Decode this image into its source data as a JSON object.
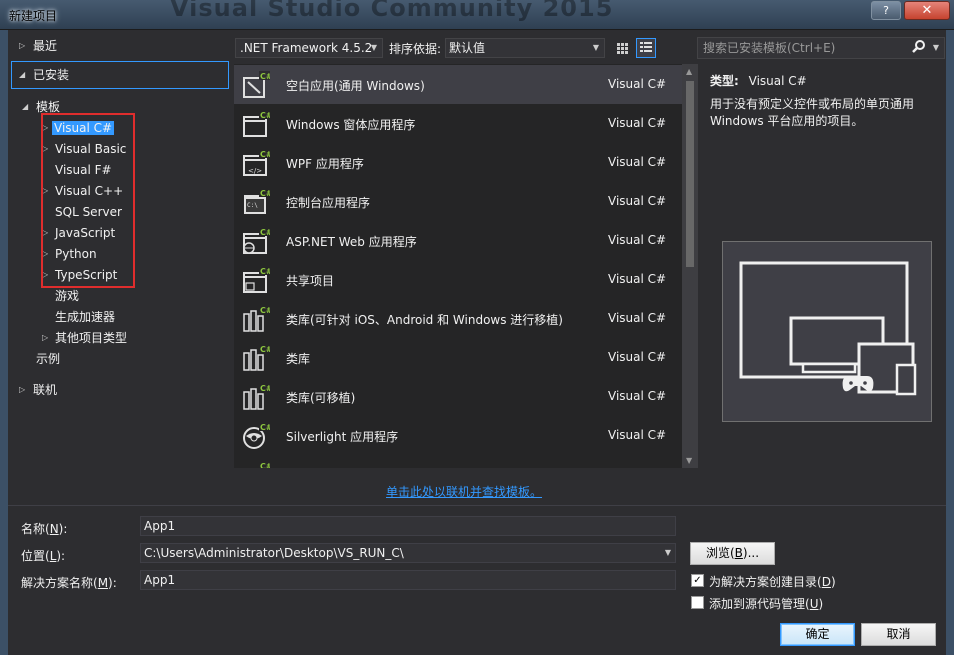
{
  "window": {
    "title": "新建项目",
    "background_title": "Visual Studio Community 2015",
    "help_button": "?",
    "close_button": "✕"
  },
  "sidebar": {
    "recent": "最近",
    "installed": "已安装",
    "templates": "模板",
    "template_languages": [
      "Visual C#",
      "Visual Basic",
      "Visual F#",
      "Visual C++",
      "SQL Server",
      "JavaScript",
      "Python",
      "TypeScript"
    ],
    "other_items": [
      "游戏",
      "生成加速器",
      "其他项目类型"
    ],
    "samples": "示例",
    "online": "联机"
  },
  "toolbar": {
    "framework": ".NET Framework 4.5.2",
    "sort_label": "排序依据:",
    "sort_value": "默认值",
    "search_placeholder": "搜索已安装模板(Ctrl+E)"
  },
  "templates": [
    {
      "name": "空白应用(通用 Windows)",
      "lang": "Visual C#"
    },
    {
      "name": "Windows 窗体应用程序",
      "lang": "Visual C#"
    },
    {
      "name": "WPF 应用程序",
      "lang": "Visual C#"
    },
    {
      "name": "控制台应用程序",
      "lang": "Visual C#"
    },
    {
      "name": "ASP.NET Web 应用程序",
      "lang": "Visual C#"
    },
    {
      "name": "共享项目",
      "lang": "Visual C#"
    },
    {
      "name": "类库(可针对 iOS、Android 和 Windows 进行移植)",
      "lang": "Visual C#"
    },
    {
      "name": "类库",
      "lang": "Visual C#"
    },
    {
      "name": "类库(可移植)",
      "lang": "Visual C#"
    },
    {
      "name": "Silverlight 应用程序",
      "lang": "Visual C#"
    }
  ],
  "details": {
    "type_label": "类型:",
    "type_value": "Visual C#",
    "description": "用于没有预定义控件或布局的单页通用 Windows 平台应用的项目。"
  },
  "online_link": "单击此处以联机并查找模板。",
  "form": {
    "name_label": "名称(",
    "name_key": "N",
    "name_value": "App1",
    "location_label": "位置(",
    "location_key": "L",
    "location_value": "C:\\Users\\Administrator\\Desktop\\VS_RUN_C\\",
    "solution_label": "解决方案名称(",
    "solution_key": "M",
    "solution_value": "App1",
    "label_end": "):",
    "browse_label": "浏览(",
    "browse_key": "B",
    "browse_end": ")...",
    "create_dir_label": "为解决方案创建目录(",
    "create_dir_key": "D",
    "create_dir_checked": true,
    "source_control_label": "添加到源代码管理(",
    "source_control_key": "U",
    "source_control_checked": false,
    "check_end": ")",
    "ok": "确定",
    "cancel": "取消"
  },
  "colors": {
    "background": "#2d2d30",
    "accent": "#3399ff",
    "csharp_badge": "#8dc63f",
    "annotation_red": "#e02d2d"
  }
}
